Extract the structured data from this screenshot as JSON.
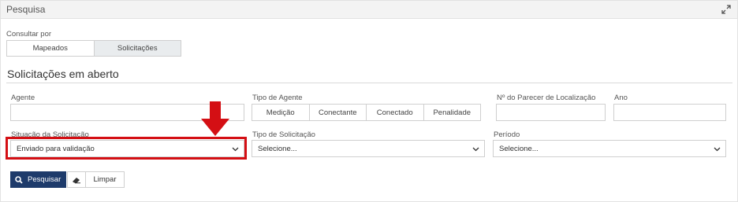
{
  "panel": {
    "title": "Pesquisa",
    "expand_icon": "expand-icon"
  },
  "consultar": {
    "label": "Consultar por",
    "options": [
      "Mapeados",
      "Solicitações"
    ],
    "selected": "Solicitações"
  },
  "section": {
    "title": "Solicitações em aberto"
  },
  "fields": {
    "agente": {
      "label": "Agente",
      "value": ""
    },
    "tipo_agente": {
      "label": "Tipo de Agente",
      "options": [
        "Medição",
        "Conectante",
        "Conectado",
        "Penalidade"
      ]
    },
    "parecer": {
      "label": "Nº do Parecer de Localização",
      "value": ""
    },
    "ano": {
      "label": "Ano",
      "value": ""
    },
    "situacao": {
      "label": "Situação da Solicitação",
      "value": "Enviado para validação"
    },
    "tipo_solicitacao": {
      "label": "Tipo de Solicitação",
      "value": "Selecione..."
    },
    "periodo": {
      "label": "Período",
      "value": "Selecione..."
    }
  },
  "buttons": {
    "search_label": "Pesquisar",
    "clear_label": "Limpar"
  },
  "annotation": {
    "highlight_color": "#d40f14"
  },
  "colors": {
    "primary": "#1e3b6b"
  }
}
